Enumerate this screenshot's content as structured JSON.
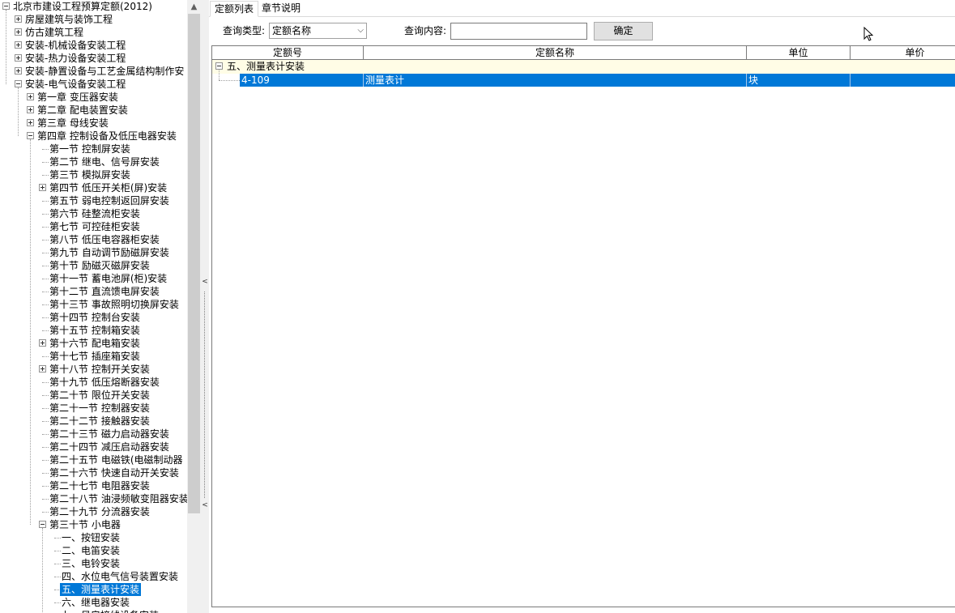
{
  "tree": {
    "items": [
      {
        "label": "北京市建设工程预算定额(2012)",
        "level": 0,
        "expander": "minus"
      },
      {
        "label": "房屋建筑与装饰工程",
        "level": 1,
        "expander": "plus"
      },
      {
        "label": "仿古建筑工程",
        "level": 1,
        "expander": "plus"
      },
      {
        "label": "安装-机械设备安装工程",
        "level": 1,
        "expander": "plus"
      },
      {
        "label": "安装-热力设备安装工程",
        "level": 1,
        "expander": "plus"
      },
      {
        "label": "安装-静置设备与工艺金属结构制作安",
        "level": 1,
        "expander": "plus"
      },
      {
        "label": "安装-电气设备安装工程",
        "level": 1,
        "expander": "minus"
      },
      {
        "label": "第一章  变压器安装",
        "level": 2,
        "expander": "plus"
      },
      {
        "label": "第二章  配电装置安装",
        "level": 2,
        "expander": "plus"
      },
      {
        "label": "第三章  母线安装",
        "level": 2,
        "expander": "plus"
      },
      {
        "label": "第四章  控制设备及低压电器安装",
        "level": 2,
        "expander": "minus"
      },
      {
        "label": "第一节  控制屏安装",
        "level": 3,
        "expander": "none"
      },
      {
        "label": "第二节  继电、信号屏安装",
        "level": 3,
        "expander": "none"
      },
      {
        "label": "第三节  模拟屏安装",
        "level": 3,
        "expander": "none"
      },
      {
        "label": "第四节  低压开关柜(屏)安装",
        "level": 3,
        "expander": "plus"
      },
      {
        "label": "第五节  弱电控制返回屏安装",
        "level": 3,
        "expander": "none"
      },
      {
        "label": "第六节  硅整流柜安装",
        "level": 3,
        "expander": "none"
      },
      {
        "label": "第七节  可控硅柜安装",
        "level": 3,
        "expander": "none"
      },
      {
        "label": "第八节  低压电容器柜安装",
        "level": 3,
        "expander": "none"
      },
      {
        "label": "第九节  自动调节励磁屏安装",
        "level": 3,
        "expander": "none"
      },
      {
        "label": "第十节  励磁灭磁屏安装",
        "level": 3,
        "expander": "none"
      },
      {
        "label": "第十一节  蓄电池屏(柜)安装",
        "level": 3,
        "expander": "none"
      },
      {
        "label": "第十二节  直流馈电屏安装",
        "level": 3,
        "expander": "none"
      },
      {
        "label": "第十三节  事故照明切换屏安装",
        "level": 3,
        "expander": "none"
      },
      {
        "label": "第十四节  控制台安装",
        "level": 3,
        "expander": "none"
      },
      {
        "label": "第十五节  控制箱安装",
        "level": 3,
        "expander": "none"
      },
      {
        "label": "第十六节  配电箱安装",
        "level": 3,
        "expander": "plus"
      },
      {
        "label": "第十七节  插座箱安装",
        "level": 3,
        "expander": "none"
      },
      {
        "label": "第十八节  控制开关安装",
        "level": 3,
        "expander": "plus"
      },
      {
        "label": "第十九节  低压熔断器安装",
        "level": 3,
        "expander": "none"
      },
      {
        "label": "第二十节  限位开关安装",
        "level": 3,
        "expander": "none"
      },
      {
        "label": "第二十一节  控制器安装",
        "level": 3,
        "expander": "none"
      },
      {
        "label": "第二十二节  接触器安装",
        "level": 3,
        "expander": "none"
      },
      {
        "label": "第二十三节  磁力启动器安装",
        "level": 3,
        "expander": "none"
      },
      {
        "label": "第二十四节  减压启动器安装",
        "level": 3,
        "expander": "none"
      },
      {
        "label": "第二十五节  电磁铁(电磁制动器",
        "level": 3,
        "expander": "none"
      },
      {
        "label": "第二十六节  快速自动开关安装",
        "level": 3,
        "expander": "none"
      },
      {
        "label": "第二十七节  电阻器安装",
        "level": 3,
        "expander": "none"
      },
      {
        "label": "第二十八节  油浸频敏变阻器安装",
        "level": 3,
        "expander": "none"
      },
      {
        "label": "第二十九节  分流器安装",
        "level": 3,
        "expander": "none"
      },
      {
        "label": "第三十节  小电器",
        "level": 3,
        "expander": "minus"
      },
      {
        "label": "一、按钮安装",
        "level": 4,
        "expander": "none"
      },
      {
        "label": "二、电笛安装",
        "level": 4,
        "expander": "none"
      },
      {
        "label": "三、电铃安装",
        "level": 4,
        "expander": "none"
      },
      {
        "label": "四、水位电气信号装置安装",
        "level": 4,
        "expander": "none"
      },
      {
        "label": "五、测量表计安装",
        "level": 4,
        "expander": "none",
        "selected": true
      },
      {
        "label": "六、继电器安装",
        "level": 4,
        "expander": "none"
      },
      {
        "label": "七、风扇接线设备安装",
        "level": 4,
        "expander": "none"
      }
    ]
  },
  "tabs": [
    {
      "label": "定额列表",
      "active": true
    },
    {
      "label": "章节说明",
      "active": false
    }
  ],
  "query": {
    "type_label": "查询类型:",
    "type_value": "定额名称",
    "content_label": "查询内容:",
    "content_value": "",
    "confirm_label": "确定"
  },
  "grid": {
    "columns": [
      "定额号",
      "定额名称",
      "单位",
      "单价"
    ],
    "group_label": "五、测量表计安装",
    "rows": [
      {
        "code": "4-109",
        "name": "测量表计",
        "unit": "块",
        "price": ""
      }
    ]
  },
  "icons": {
    "scroll_up": "scroll-up-arrow-icon",
    "dropdown": "chevron-down-icon",
    "splitter_arrow": "chevron-left-icon",
    "cursor": "mouse-pointer-icon"
  },
  "colors": {
    "selection": "#0078d7",
    "group_row_bg": "#fffde6",
    "scrollbar_thumb": "#cdcdcd"
  }
}
